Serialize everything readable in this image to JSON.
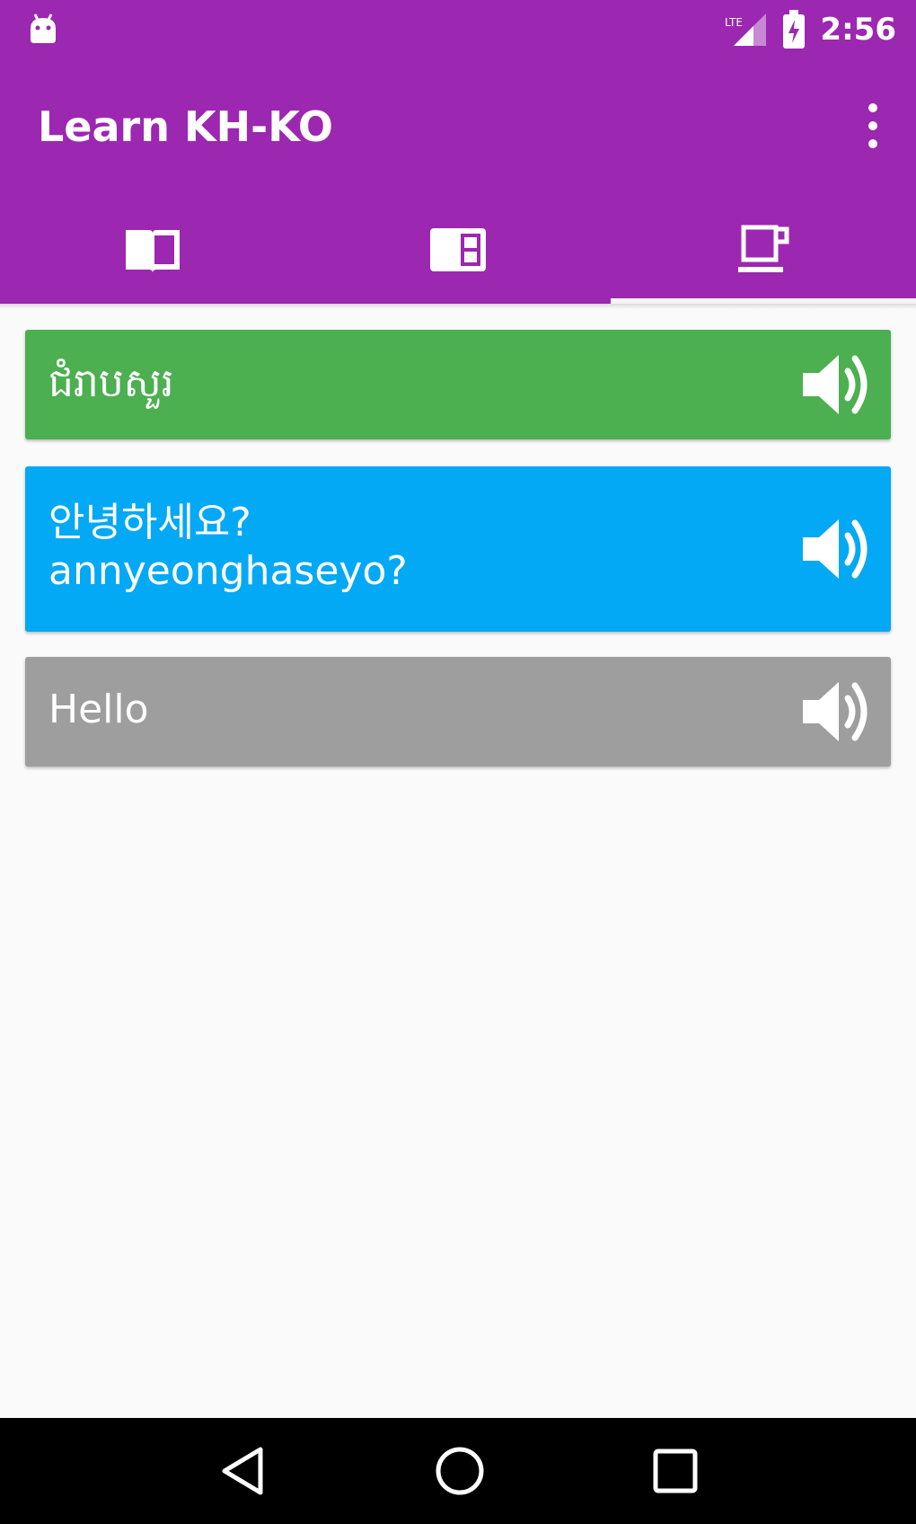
{
  "status_bar": {
    "time": "2:56",
    "icons": [
      "android-icon",
      "signal-icon",
      "battery-icon"
    ]
  },
  "app_bar": {
    "title": "Learn KH-KO",
    "menu_icon": "overflow-menu-icon"
  },
  "tabs": [
    {
      "icon": "book-icon",
      "active": false
    },
    {
      "icon": "flashcard-icon",
      "active": false
    },
    {
      "icon": "coffee-cup-icon",
      "active": true
    }
  ],
  "cards": {
    "khmer": {
      "text": "ជំរាបសួរ",
      "color": "#4CAF50"
    },
    "korean": {
      "text": "안녕하세요?",
      "romanization": "annyeonghaseyo?",
      "color": "#03A9F4"
    },
    "english": {
      "text": "Hello",
      "color": "#9E9E9E"
    }
  },
  "colors": {
    "primary": "#9C27B0",
    "background": "#FAFAFA"
  },
  "nav_bar": {
    "icons": [
      "back-icon",
      "home-icon",
      "recents-icon"
    ]
  }
}
